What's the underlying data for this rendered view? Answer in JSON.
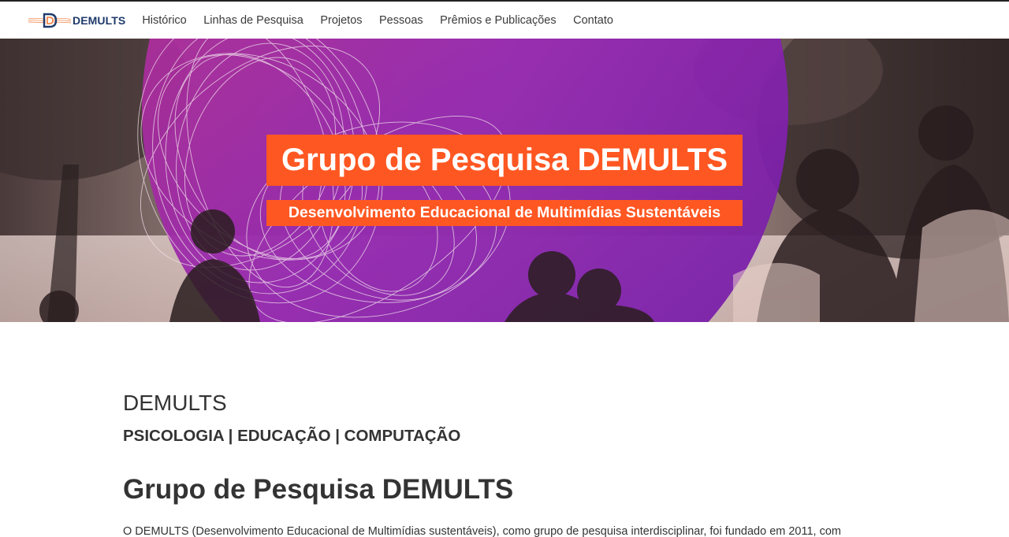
{
  "nav": {
    "brand": "DEMULTS",
    "links": [
      "Histórico",
      "Linhas de Pesquisa",
      "Projetos",
      "Pessoas",
      "Prêmios e Publicações",
      "Contato"
    ]
  },
  "hero": {
    "title": "Grupo de Pesquisa DEMULTS",
    "subtitle": "Desenvolvimento Educacional de Multimídias Sustentáveis"
  },
  "main": {
    "heading": "DEMULTS",
    "areas": "PSICOLOGIA | EDUCAÇÃO | COMPUTAÇÃO",
    "section_title": "Grupo de Pesquisa DEMULTS",
    "intro": "O DEMULTS (Desenvolvimento Educacional de Multimídias sustentáveis), como grupo de pesquisa interdisciplinar, foi fundado em 2011, com"
  },
  "colors": {
    "accent": "#ff5722",
    "brand": "#1f3a6b",
    "hero_purple": "#a020c0"
  }
}
